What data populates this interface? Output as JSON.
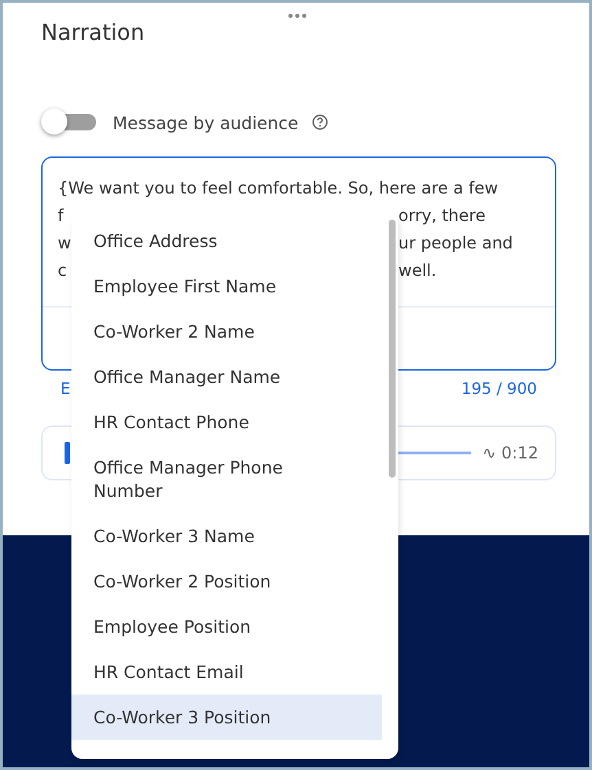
{
  "panel": {
    "title": "Narration"
  },
  "toggle": {
    "label": "Message by audience",
    "on": false
  },
  "message": {
    "lines": [
      {
        "left": "{We want you to feel comfortable. So, here are a few"
      },
      {
        "left": "f",
        "right": "orry, there"
      },
      {
        "left": "w",
        "right": "ur people and"
      },
      {
        "left": "c",
        "right": "well."
      }
    ],
    "link_fragment": "E",
    "counter": "195 / 900"
  },
  "audio": {
    "duration": "∿ 0:12"
  },
  "dropdown": {
    "items": [
      {
        "label": "Office Address",
        "selected": false
      },
      {
        "label": "Employee First Name",
        "selected": false
      },
      {
        "label": "Co-Worker 2 Name",
        "selected": false
      },
      {
        "label": "Office Manager Name",
        "selected": false
      },
      {
        "label": "HR Contact Phone",
        "selected": false
      },
      {
        "label": "Office Manager Phone Number",
        "selected": false
      },
      {
        "label": "Co-Worker 3 Name",
        "selected": false
      },
      {
        "label": "Co-Worker 2 Position",
        "selected": false
      },
      {
        "label": "Employee Position",
        "selected": false
      },
      {
        "label": "HR Contact Email",
        "selected": false
      },
      {
        "label": "Co-Worker 3 Position",
        "selected": true
      }
    ]
  }
}
